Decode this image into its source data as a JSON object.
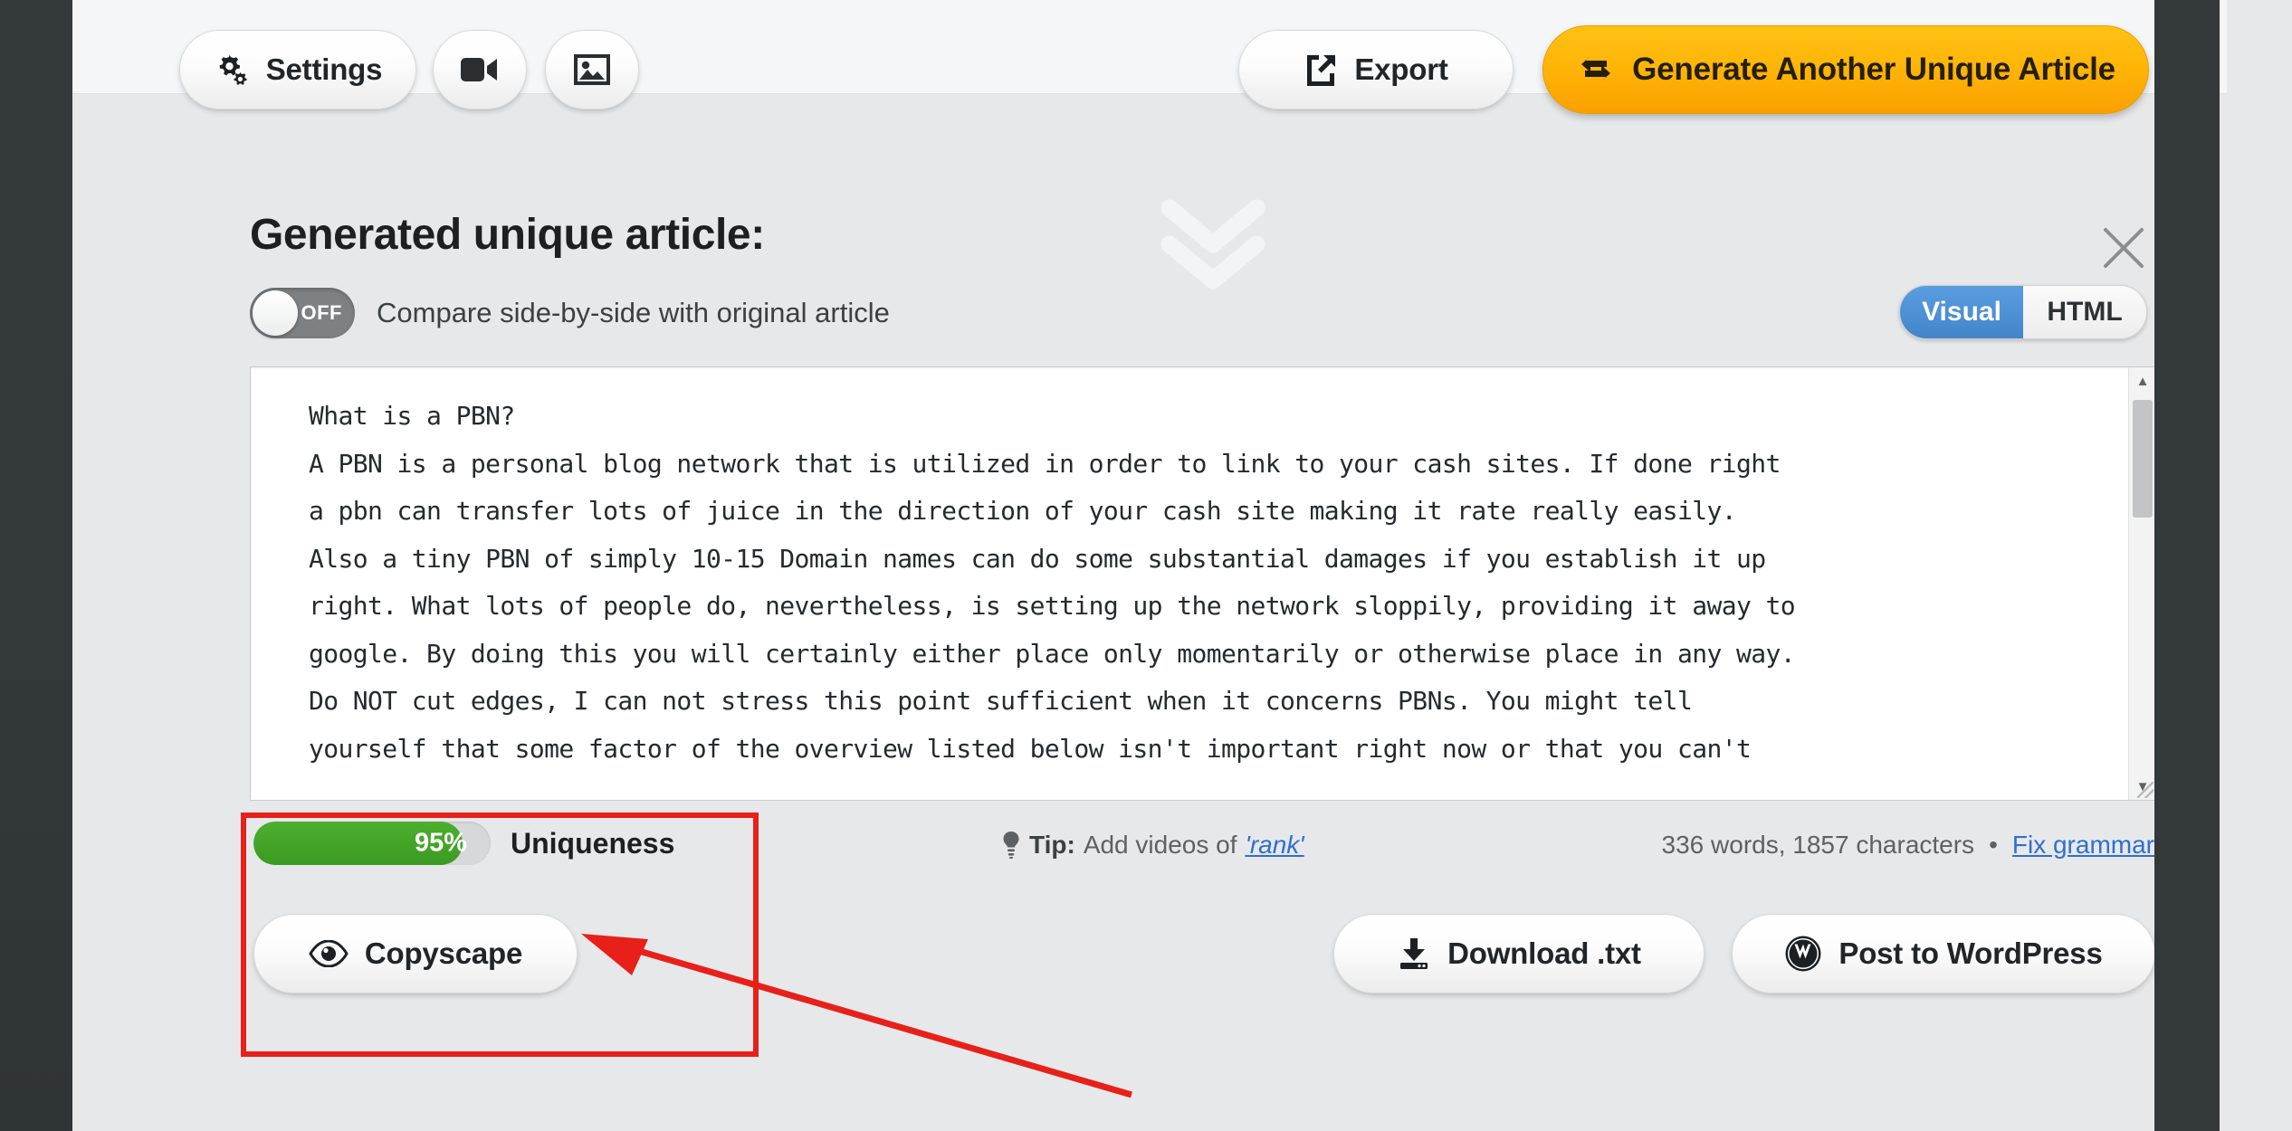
{
  "toolbar": {
    "settings_label": "Settings",
    "video_icon": "video-camera-icon",
    "image_icon": "image-icon",
    "export_label": "Export",
    "generate_label": "Generate Another Unique Article"
  },
  "panel": {
    "title": "Generated unique article:",
    "close_label": "×",
    "compare_toggle": {
      "state_label": "OFF",
      "label": "Compare side-by-side with original article",
      "checked": false
    },
    "view_switch": {
      "options": [
        "Visual",
        "HTML"
      ],
      "active": "Visual"
    }
  },
  "editor": {
    "content": "What is a PBN?\nA PBN is a personal blog network that is utilized in order to link to your cash sites. If done right\na pbn can transfer lots of juice in the direction of your cash site making it rate really easily.\nAlso a tiny PBN of simply 10-15 Domain names can do some substantial damages if you establish it up\nright. What lots of people do, nevertheless, is setting up the network sloppily, providing it away to\ngoogle. By doing this you will certainly either place only momentarily or otherwise place in any way.\nDo NOT cut edges, I can not stress this point sufficient when it concerns PBNs. You might tell\nyourself that some factor of the overview listed below isn't important right now or that you can't"
  },
  "status": {
    "uniqueness_percent": "95%",
    "uniqueness_label": "Uniqueness",
    "tip_prefix": "Tip:",
    "tip_text": "Add videos of",
    "tip_link": "'rank'",
    "counts_text": "336 words, 1857 characters",
    "counts_separator": "•",
    "fix_grammar_label": "Fix grammar"
  },
  "actions": {
    "copyscape_label": "Copyscape",
    "download_label": "Download .txt",
    "wordpress_label": "Post to WordPress"
  },
  "colors": {
    "accent_orange": "#ffb608",
    "uniqueness_green": "#3c9a22",
    "switch_blue": "#4285c8",
    "link_blue": "#2f6fd0",
    "annotation_red": "#e8201a"
  }
}
